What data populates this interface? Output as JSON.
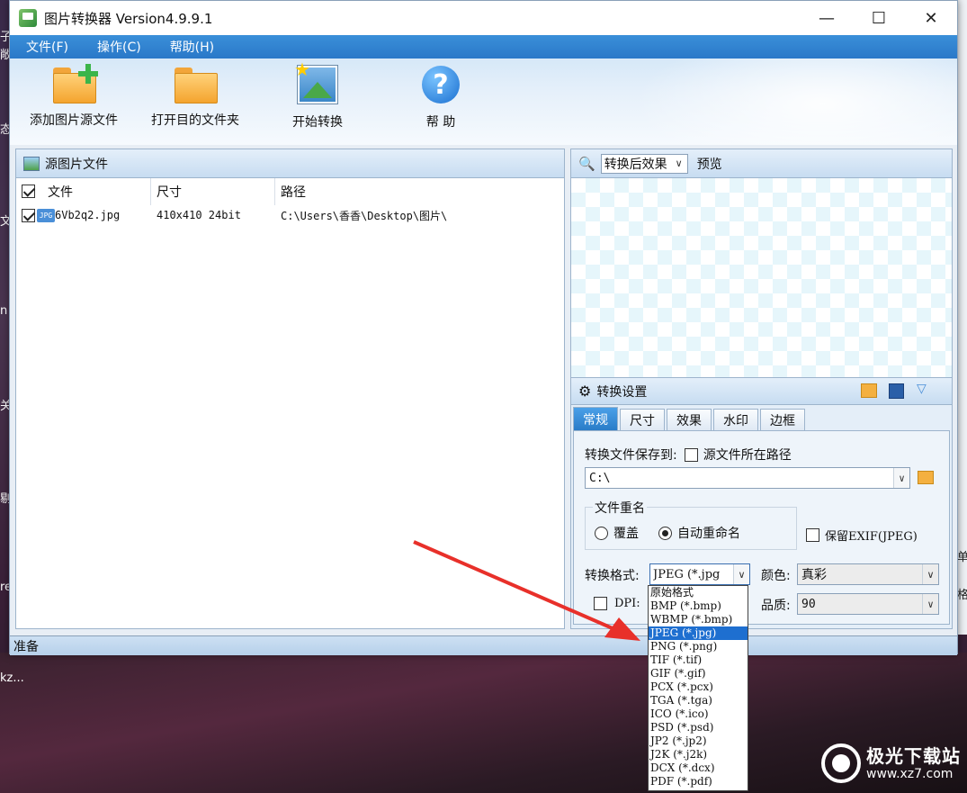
{
  "window": {
    "title": "图片转换器 Version4.9.9.1",
    "controls": {
      "minimize": "—",
      "maximize": "☐",
      "close": "✕"
    }
  },
  "menu": [
    "文件(F)",
    "操作(C)",
    "帮助(H)"
  ],
  "toolbar": {
    "add": "添加图片源文件",
    "open": "打开目的文件夹",
    "start": "开始转换",
    "help": "帮 助"
  },
  "source_panel": {
    "title": "源图片文件",
    "columns": [
      "文件",
      "尺寸",
      "路径"
    ],
    "rows": [
      {
        "file": "6Vb2q2.jpg",
        "size": "410x410  24bit",
        "path": "C:\\Users\\香香\\Desktop\\图片\\",
        "checked": true,
        "icon": "JPG"
      }
    ]
  },
  "preview_panel": {
    "mode": "转换后效果",
    "label": "预览"
  },
  "settings": {
    "title": "转换设置",
    "tabs": [
      "常规",
      "尺寸",
      "效果",
      "水印",
      "边框"
    ],
    "active_tab": "常规",
    "save_to_label": "转换文件保存到:",
    "source_path_label": "源文件所在路径",
    "save_path": "C:\\",
    "rename_group": "文件重名",
    "overwrite": "覆盖",
    "auto_rename": "自动重命名",
    "keep_exif": "保留EXIF(JPEG)",
    "format_label": "转换格式:",
    "format_value": "JPEG (*.jpg",
    "color_label": "颜色:",
    "color_value": "真彩",
    "dpi_label": "DPI:",
    "quality_label": "品质:",
    "quality_value": "90"
  },
  "format_options": [
    "原始格式",
    "BMP (*.bmp)",
    "WBMP (*.bmp)",
    "JPEG (*.jpg)",
    "PNG (*.png)",
    "TIF (*.tif)",
    "GIF (*.gif)",
    "PCX (*.pcx)",
    "TGA (*.tga)",
    "ICO (*.ico)",
    "PSD (*.psd)",
    "JP2 (*.jp2)",
    "J2K (*.j2k)",
    "DCX (*.dcx)",
    "PDF (*.pdf)"
  ],
  "selected_format_index": 3,
  "status": "准备",
  "desktop": {
    "left_fragments": [
      "子",
      "敞",
      "态",
      "文",
      "n",
      "关",
      "剔",
      "re",
      "kz..."
    ],
    "right_fragments": [
      "单",
      "格"
    ]
  },
  "watermark": {
    "name": "极光下载站",
    "url": "www.xz7.com"
  },
  "colors": {
    "menubar": "#2a78c8",
    "selection": "#1e6fd0",
    "arrow": "#e8302a"
  }
}
